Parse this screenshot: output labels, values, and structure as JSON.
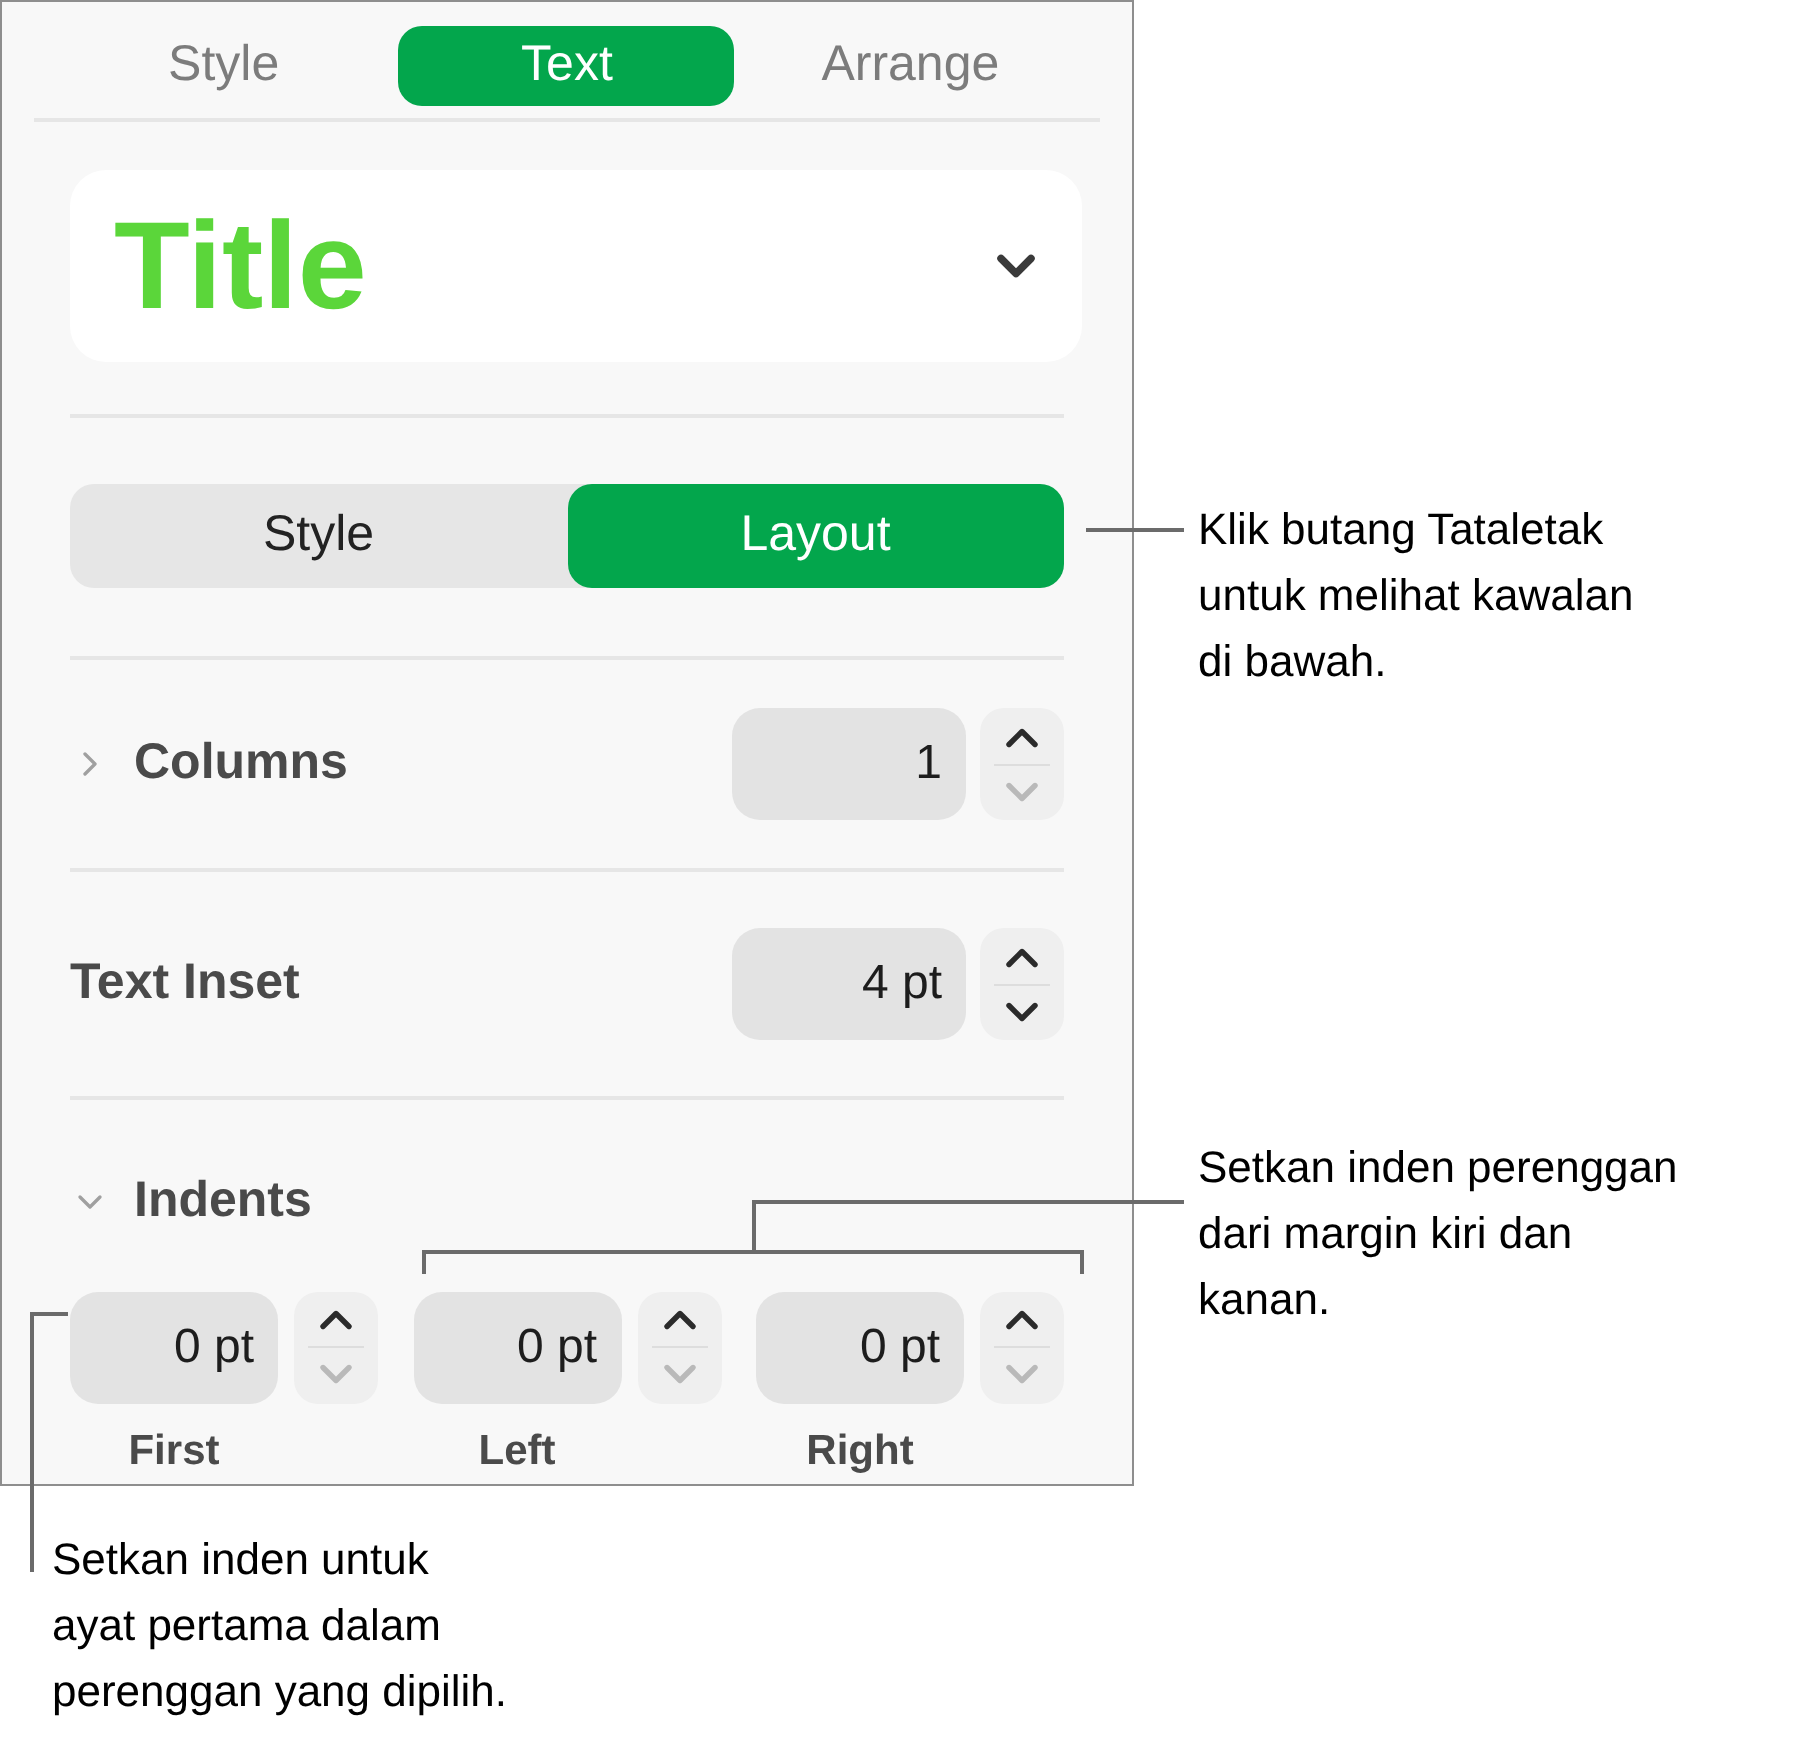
{
  "inspector_tabs": [
    {
      "label": "Style",
      "selected": false
    },
    {
      "label": "Text",
      "selected": true
    },
    {
      "label": "Arrange",
      "selected": false
    }
  ],
  "paragraph_style": {
    "value": "Title"
  },
  "segments": [
    {
      "label": "Style",
      "selected": false
    },
    {
      "label": "Layout",
      "selected": true
    }
  ],
  "columns": {
    "label": "Columns",
    "expanded": false,
    "value": "1",
    "down_disabled": true
  },
  "text_inset": {
    "label": "Text Inset",
    "value": "4 pt",
    "down_disabled": false
  },
  "indents": {
    "label": "Indents",
    "expanded": true,
    "fields": [
      {
        "label": "First",
        "value": "0 pt",
        "down_disabled": true
      },
      {
        "label": "Left",
        "value": "0 pt",
        "down_disabled": true
      },
      {
        "label": "Right",
        "value": "0 pt",
        "down_disabled": true
      }
    ]
  },
  "callouts": [
    "Klik butang Tataletak\nuntuk melihat kawalan\ndi bawah.",
    "Setkan inden perenggan\ndari margin kiri dan\nkanan.",
    "Setkan inden untuk\nayat pertama dalam\nperenggan yang dipilih."
  ]
}
